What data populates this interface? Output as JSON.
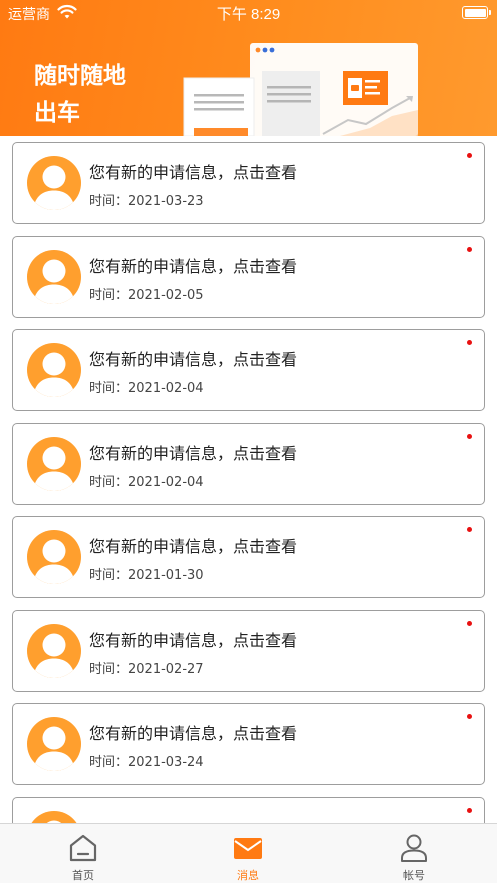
{
  "status_bar": {
    "carrier": "运营商",
    "time": "下午 8:29"
  },
  "header": {
    "slogan_line1": "随时随地",
    "slogan_line2": "出车"
  },
  "messages": [
    {
      "title": "您有新的申请信息，点击查看",
      "time": "时间：2021-03-23",
      "unread": true
    },
    {
      "title": "您有新的申请信息，点击查看",
      "time": "时间：2021-02-05",
      "unread": true
    },
    {
      "title": "您有新的申请信息，点击查看",
      "time": "时间：2021-02-04",
      "unread": true
    },
    {
      "title": "您有新的申请信息，点击查看",
      "time": "时间：2021-02-04",
      "unread": true
    },
    {
      "title": "您有新的申请信息，点击查看",
      "time": "时间：2021-01-30",
      "unread": true
    },
    {
      "title": "您有新的申请信息，点击查看",
      "time": "时间：2021-02-27",
      "unread": true
    },
    {
      "title": "您有新的申请信息，点击查看",
      "time": "时间：2021-03-24",
      "unread": true
    },
    {
      "title": "",
      "time": "",
      "unread": true
    }
  ],
  "tabbar": {
    "items": [
      {
        "label": "首页",
        "icon": "home-icon",
        "active": false
      },
      {
        "label": "消息",
        "icon": "envelope-icon",
        "active": true
      },
      {
        "label": "帐号",
        "icon": "user-icon",
        "active": false
      }
    ]
  },
  "colors": {
    "accent": "#ff7a12",
    "avatar": "#ff9f2e",
    "unread_dot": "#e81111",
    "card_border": "#9d9d9d"
  }
}
